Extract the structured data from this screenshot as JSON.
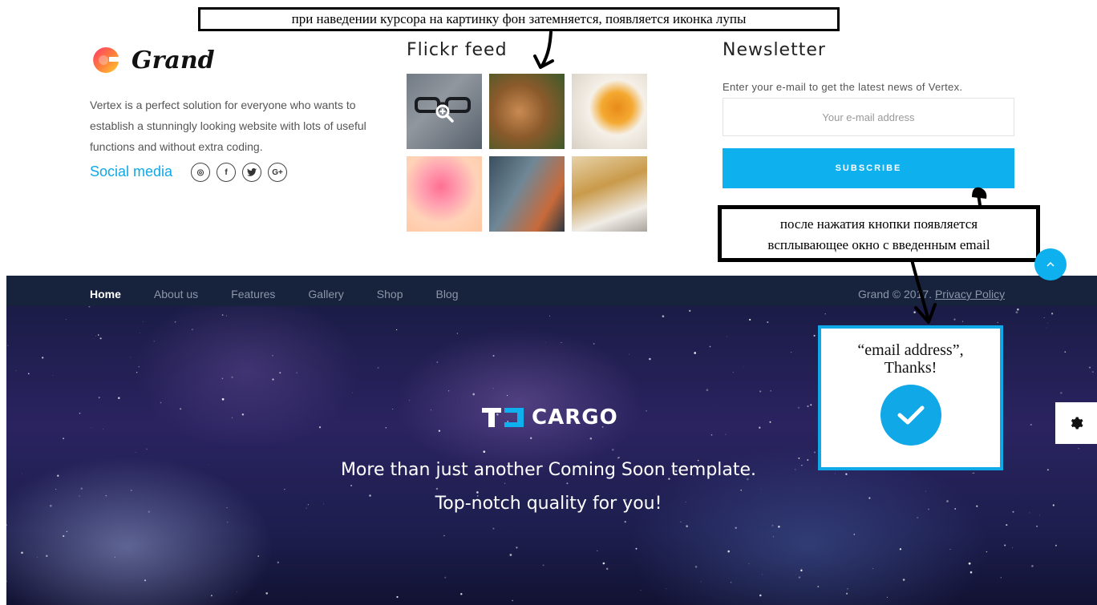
{
  "annotations": {
    "top_note": "при наведении курсора на картинку фон затемняется, появляется иконка лупы",
    "subscribe_note_line1": "после нажатия кнопки появляется",
    "subscribe_note_line2": "всплывающее окно с введенным email"
  },
  "brand": {
    "logo_text": "Grand",
    "about": "Vertex is a perfect solution for everyone who wants to establish a stunningly looking website with lots of useful functions and without extra coding.",
    "social_label": "Social media",
    "social_icons": [
      {
        "icon": "instagram-icon",
        "glyph": "◎"
      },
      {
        "icon": "facebook-icon",
        "glyph": "f"
      },
      {
        "icon": "twitter-icon",
        "glyph": "✓"
      },
      {
        "icon": "google-plus-icon",
        "glyph": "G+"
      }
    ]
  },
  "flickr": {
    "title": "Flickr feed",
    "thumbnails": [
      "glasses-on-keyboard",
      "cookies",
      "tea-cup",
      "grapefruit",
      "man-with-glasses",
      "woman-with-glasses"
    ]
  },
  "newsletter": {
    "title": "Newsletter",
    "description": "Enter your e-mail to get the latest news of Vertex.",
    "email_placeholder": "Your e-mail address",
    "subscribe_label": "SUBSCRIBE"
  },
  "nav": {
    "items": [
      {
        "label": "Home",
        "active": true
      },
      {
        "label": "About us",
        "active": false
      },
      {
        "label": "Features",
        "active": false
      },
      {
        "label": "Gallery",
        "active": false
      },
      {
        "label": "Shop",
        "active": false
      },
      {
        "label": "Blog",
        "active": false
      }
    ],
    "copyright": "Grand © 2017.",
    "privacy_link": "Privacy Policy"
  },
  "hero": {
    "logo_text": "CARGO",
    "tagline_line1": "More than just another Coming Soon template.",
    "tagline_line2": "Top-notch quality for you!"
  },
  "popup": {
    "email_line": "“email address”,",
    "thanks": "Thanks!"
  },
  "colors": {
    "accent": "#0fb0ee",
    "nav_bg": "#17233d",
    "social_label": "#10a8e6"
  }
}
